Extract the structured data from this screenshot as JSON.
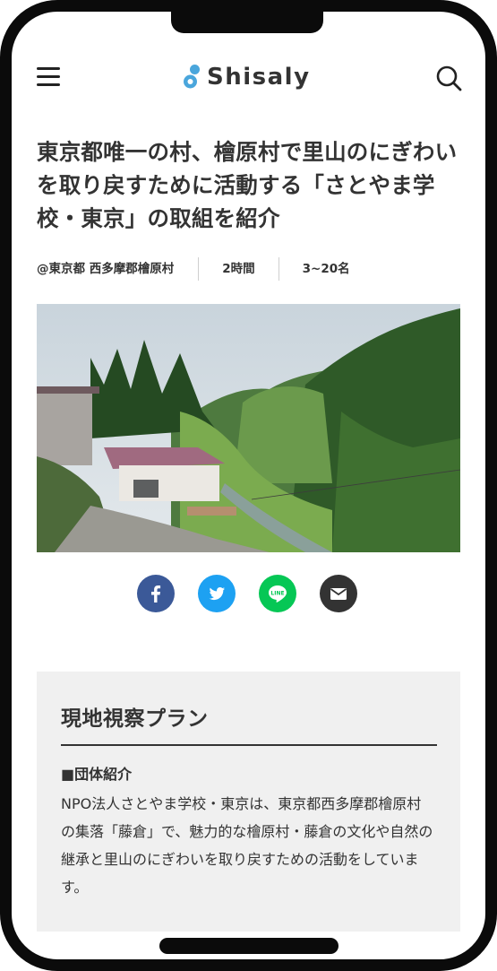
{
  "header": {
    "brand": "Shisaly",
    "menu_icon": "hamburger-menu-icon",
    "search_icon": "search-icon"
  },
  "article": {
    "title": "東京都唯一の村、檜原村で里山のにぎわいを取り戻すために活動する「さとやま学校・東京」の取組を紹介",
    "location": "@東京都 西多摩郡檜原村",
    "duration": "2時間",
    "capacity": "3~20名"
  },
  "share": [
    {
      "name": "facebook",
      "color": "#3b5998"
    },
    {
      "name": "twitter",
      "color": "#1da1f2"
    },
    {
      "name": "line",
      "color": "#06c755"
    },
    {
      "name": "email",
      "color": "#333333"
    }
  ],
  "plan": {
    "title": "現地視察プラン",
    "section_label": "■団体紹介",
    "body": "NPO法人さとやま学校・東京は、東京都西多摩郡檜原村の集落「藤倉」で、魅力的な檜原村・藤倉の文化や自然の継承と里山のにぎわいを取り戻すための活動をしています。"
  },
  "colors": {
    "text": "#333333",
    "card_bg": "#f0f0f0",
    "logo_blue": "#4aa6dc"
  }
}
